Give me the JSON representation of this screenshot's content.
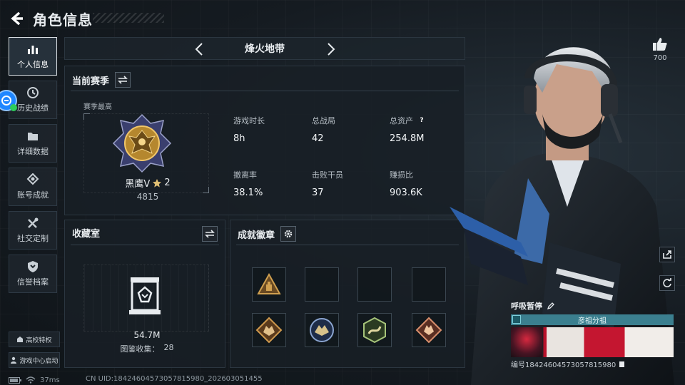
{
  "header": {
    "title": "角色信息"
  },
  "sidebar": {
    "items": [
      {
        "label": "个人信息",
        "icon": "bar-chart-icon",
        "active": true
      },
      {
        "label": "历史战绩",
        "icon": "clock-icon",
        "active": false
      },
      {
        "label": "详细数据",
        "icon": "folder-icon",
        "active": false
      },
      {
        "label": "账号成就",
        "icon": "medal-icon",
        "active": false
      },
      {
        "label": "社交定制",
        "icon": "tools-icon",
        "active": false
      },
      {
        "label": "信誉档案",
        "icon": "shield-icon",
        "active": false
      }
    ],
    "campus_label": "高校特权",
    "game_center_label": "游戏中心启动"
  },
  "mode": {
    "title": "烽火地带"
  },
  "season": {
    "title": "当前赛季",
    "subtitle": "赛季最高",
    "rank_name": "黑鹰V",
    "rank_stars": "2",
    "rank_score": "4815",
    "stats": [
      {
        "label": "游戏时长",
        "value": "8h"
      },
      {
        "label": "总战局",
        "value": "42"
      },
      {
        "label": "总资产",
        "value": "254.8M",
        "has_help": true
      },
      {
        "label": "撤离率",
        "value": "38.1%"
      },
      {
        "label": "击败干员",
        "value": "37"
      },
      {
        "label": "赚损比",
        "value": "903.6K"
      }
    ]
  },
  "collection": {
    "title": "收藏室",
    "value": "54.7M",
    "count_label": "图鉴收集：",
    "count_value": "28"
  },
  "achievements": {
    "title": "成就徽章",
    "badges": [
      {
        "icon": "triangle-badge-icon",
        "filled": true,
        "color": "#c9903a"
      },
      {
        "icon": "empty-slot",
        "filled": false
      },
      {
        "icon": "empty-slot",
        "filled": false
      },
      {
        "icon": "empty-slot",
        "filled": false
      },
      {
        "icon": "wolf-badge-icon",
        "filled": true,
        "color": "#c9903a"
      },
      {
        "icon": "eagle-badge-icon",
        "filled": true,
        "color": "#6f8fb8"
      },
      {
        "icon": "snake-badge-icon",
        "filled": true,
        "color": "#8fb86f"
      },
      {
        "icon": "tiger-badge-icon",
        "filled": true,
        "color": "#d08a6a"
      }
    ]
  },
  "profile": {
    "like_count": "700",
    "player_name": "呼吸暂停",
    "group_name": "彦祖分祖",
    "uid_line": "编号1842460457305781598​0"
  },
  "status": {
    "ping": "37ms",
    "footer_uid": "CN UID:1842460457305781598​0_202603051455"
  }
}
